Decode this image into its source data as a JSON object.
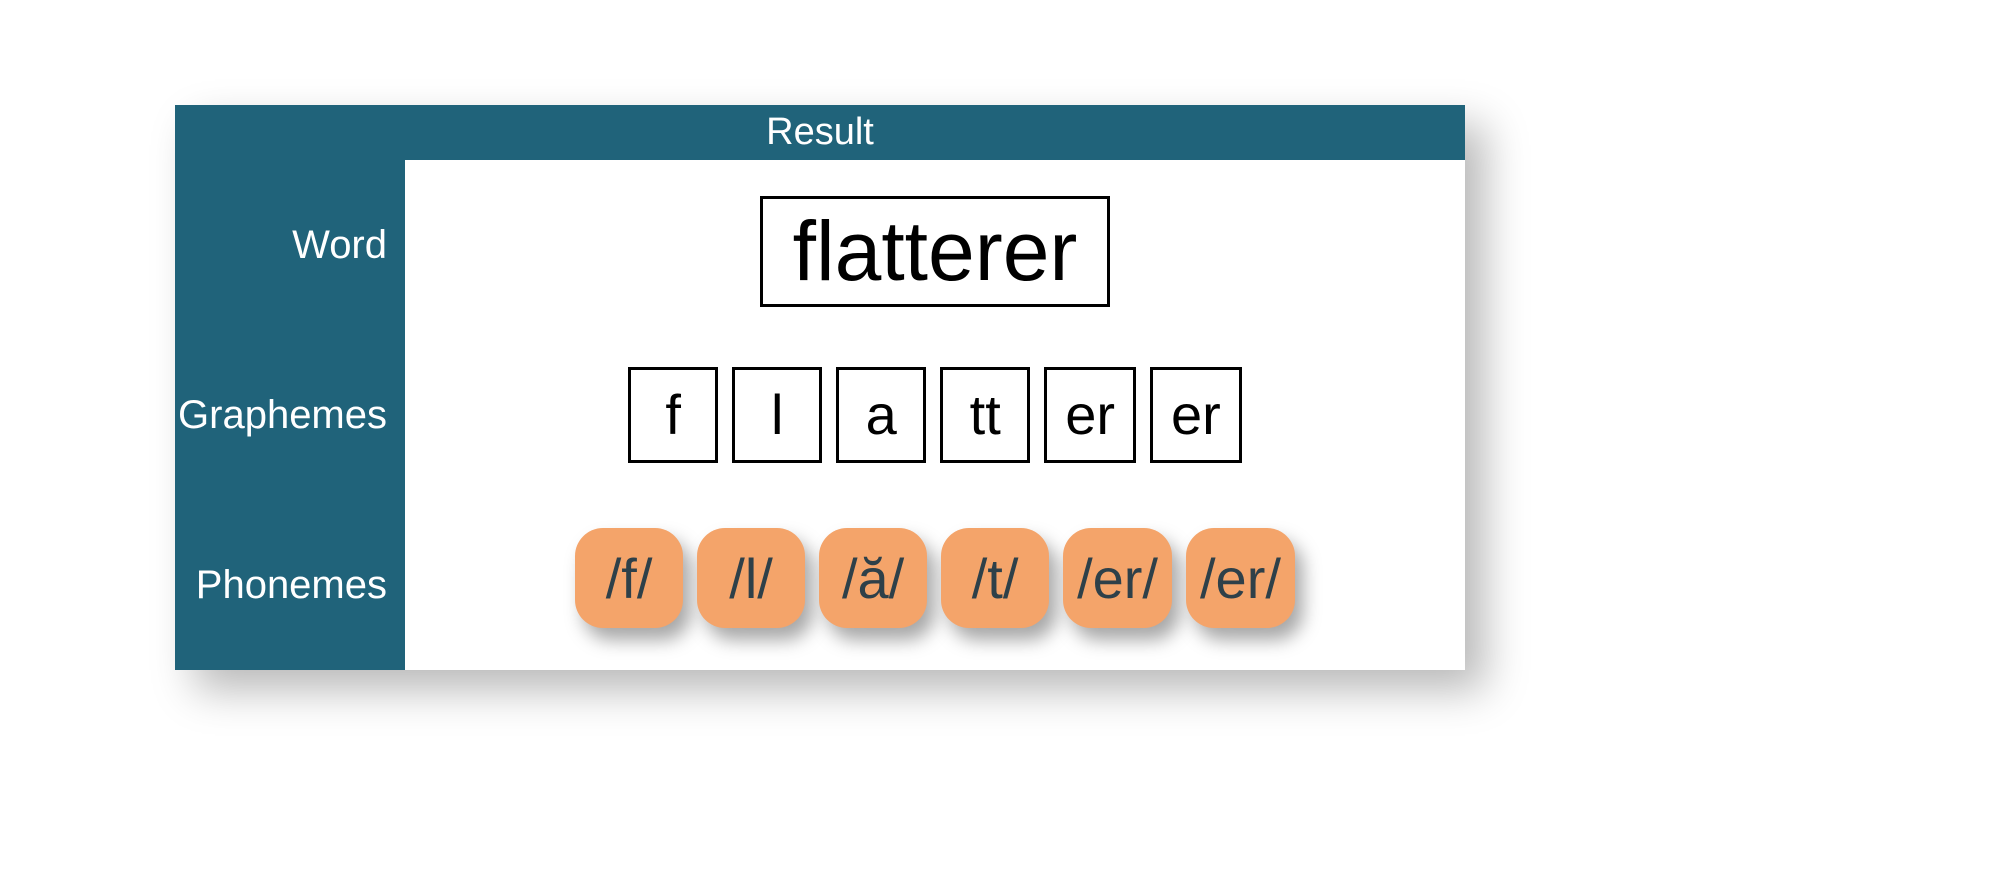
{
  "colors": {
    "teal": "#20637a",
    "orange": "#f4a46a",
    "chipText": "#2e4049"
  },
  "header": "Result",
  "labels": {
    "word": "Word",
    "graphemes": "Graphemes",
    "phonemes": "Phonemes"
  },
  "word": "flatterer",
  "graphemes": [
    "f",
    "l",
    "a",
    "tt",
    "er",
    "er"
  ],
  "phonemes": [
    "/f/",
    "/l/",
    "/ă/",
    "/t/",
    "/er/",
    "/er/"
  ]
}
